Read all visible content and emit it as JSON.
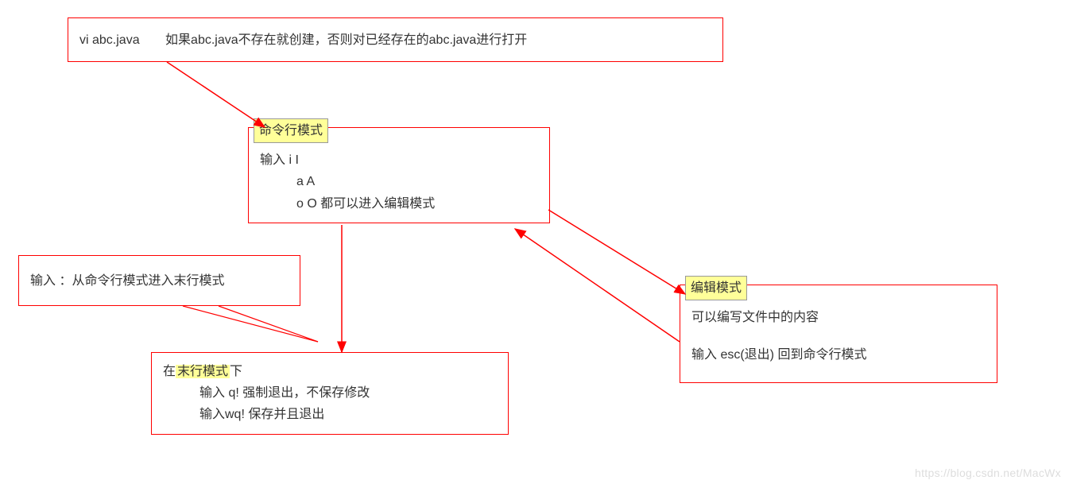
{
  "top_box": {
    "cmd": "vi  abc.java",
    "desc": "如果abc.java不存在就创建，否则对已经存在的abc.java进行打开"
  },
  "cmd_mode": {
    "title": "命令行模式",
    "line1": "输入 i  I",
    "line2": "a A",
    "line3": "o O 都可以进入编辑模式"
  },
  "colon_note": {
    "text": "输入 ：从命令行模式进入末行模式"
  },
  "last_line_mode": {
    "prefix": "在",
    "hl": "末行模式",
    "suffix": "下",
    "line2": "输入 q! 强制退出，不保存修改",
    "line3": "输入wq! 保存并且退出"
  },
  "edit_mode": {
    "title": "编辑模式",
    "line1": "可以编写文件中的内容",
    "line2": "输入 esc(退出) 回到命令行模式"
  },
  "watermark": "https://blog.csdn.net/MacWx"
}
